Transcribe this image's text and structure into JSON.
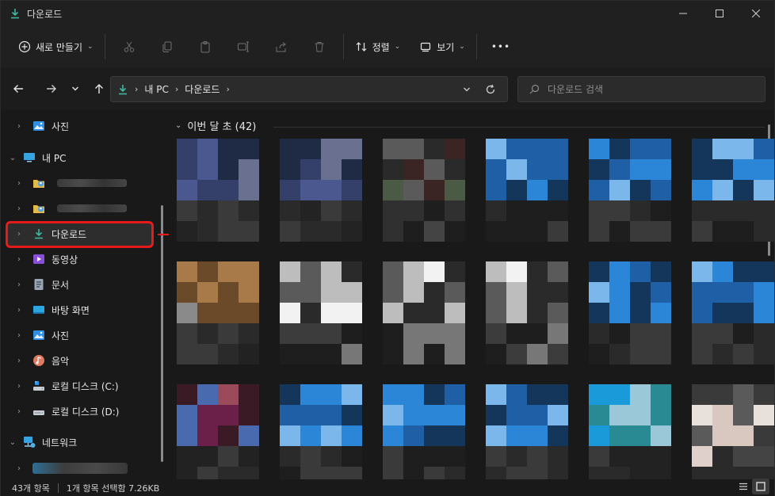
{
  "window": {
    "title": "다운로드"
  },
  "commandbar": {
    "new_label": "새로 만들기",
    "sort_label": "정렬",
    "view_label": "보기",
    "more_label": "•••"
  },
  "address": {
    "crumbs": [
      "내 PC",
      "다운로드"
    ],
    "search_placeholder": "다운로드 검색"
  },
  "sidebar": {
    "items": [
      {
        "label": "사진"
      },
      {
        "label": "내 PC"
      },
      {
        "label": ""
      },
      {
        "label": ""
      },
      {
        "label": "다운로드"
      },
      {
        "label": "동영상"
      },
      {
        "label": "문서"
      },
      {
        "label": "바탕 화면"
      },
      {
        "label": "사진"
      },
      {
        "label": "음악"
      },
      {
        "label": "로컬 디스크 (C:)"
      },
      {
        "label": "로컬 디스크 (D:)"
      },
      {
        "label": "네트워크"
      }
    ]
  },
  "content": {
    "group_label": "이번 달 초 (42)"
  },
  "status": {
    "item_count": "43개 항목",
    "selection": "1개 항목 선택함 7.26KB"
  },
  "colors": {
    "accent": "#e51b1b",
    "folder_green": "#3fb6a0"
  }
}
